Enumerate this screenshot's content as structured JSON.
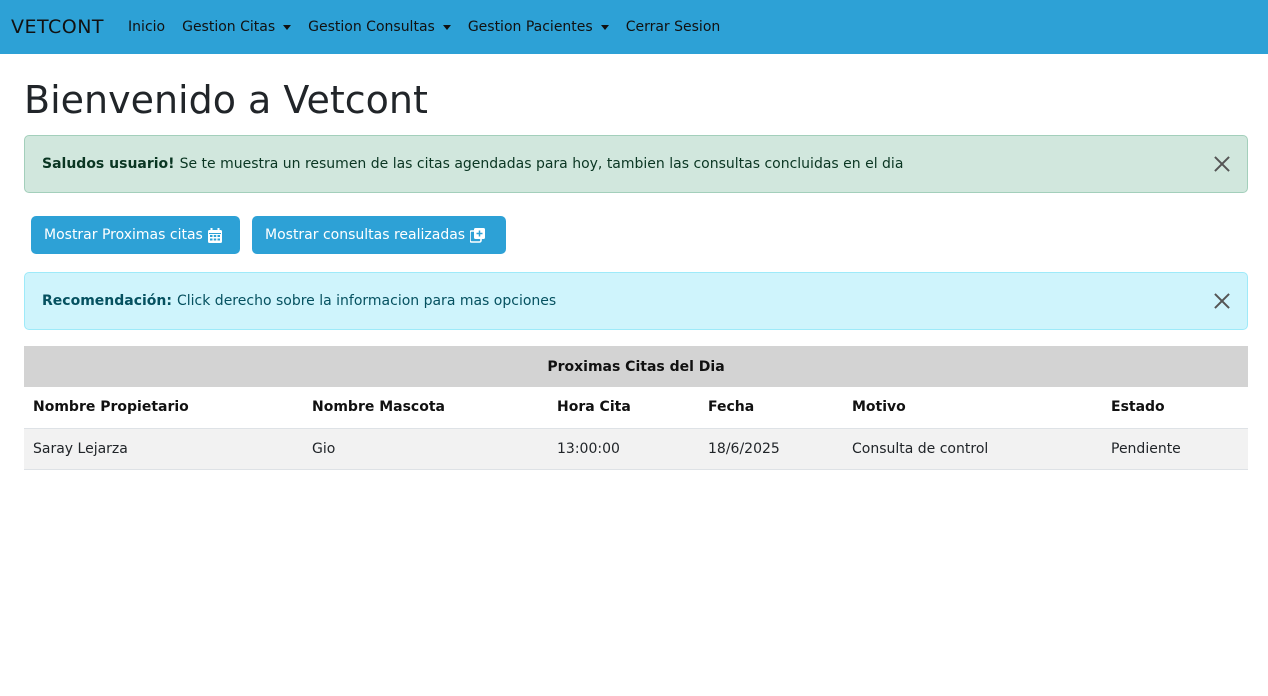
{
  "navbar": {
    "brand": "VETCONT",
    "items": [
      {
        "label": "Inicio"
      },
      {
        "label": "Gestion Citas"
      },
      {
        "label": "Gestion Consultas"
      },
      {
        "label": "Gestion Pacientes"
      },
      {
        "label": "Cerrar Sesion"
      }
    ]
  },
  "page": {
    "title": "Bienvenido a Vetcont"
  },
  "alert_success": {
    "strong": "Saludos usuario!",
    "text": "Se te muestra un resumen de las citas agendadas para hoy, tambien las consultas concluidas en el dia",
    "icon": "close-icon"
  },
  "buttons": {
    "citas_label": "Mostrar Proximas citas",
    "citas_icon": "calendar-icon",
    "consultas_label": "Mostrar consultas realizadas",
    "consultas_icon": "copy-plus-icon"
  },
  "alert_info": {
    "strong": "Recomendación:",
    "text": "Click derecho sobre la informacion para mas opciones",
    "icon": "close-icon"
  },
  "table": {
    "caption": "Proximas Citas del Dia",
    "headers": [
      "Nombre Propietario",
      "Nombre Mascota",
      "Hora Cita",
      "Fecha",
      "Motivo",
      "Estado"
    ],
    "rows": [
      [
        "Saray Lejarza",
        "Gio",
        "13:00:00",
        "18/6/2025",
        "Consulta de control",
        "Pendiente"
      ]
    ]
  },
  "colors": {
    "navbar": "#2da1d6",
    "button": "#2da1d6",
    "success_bg": "#d1e7dd",
    "info_bg": "#cff4fc"
  }
}
